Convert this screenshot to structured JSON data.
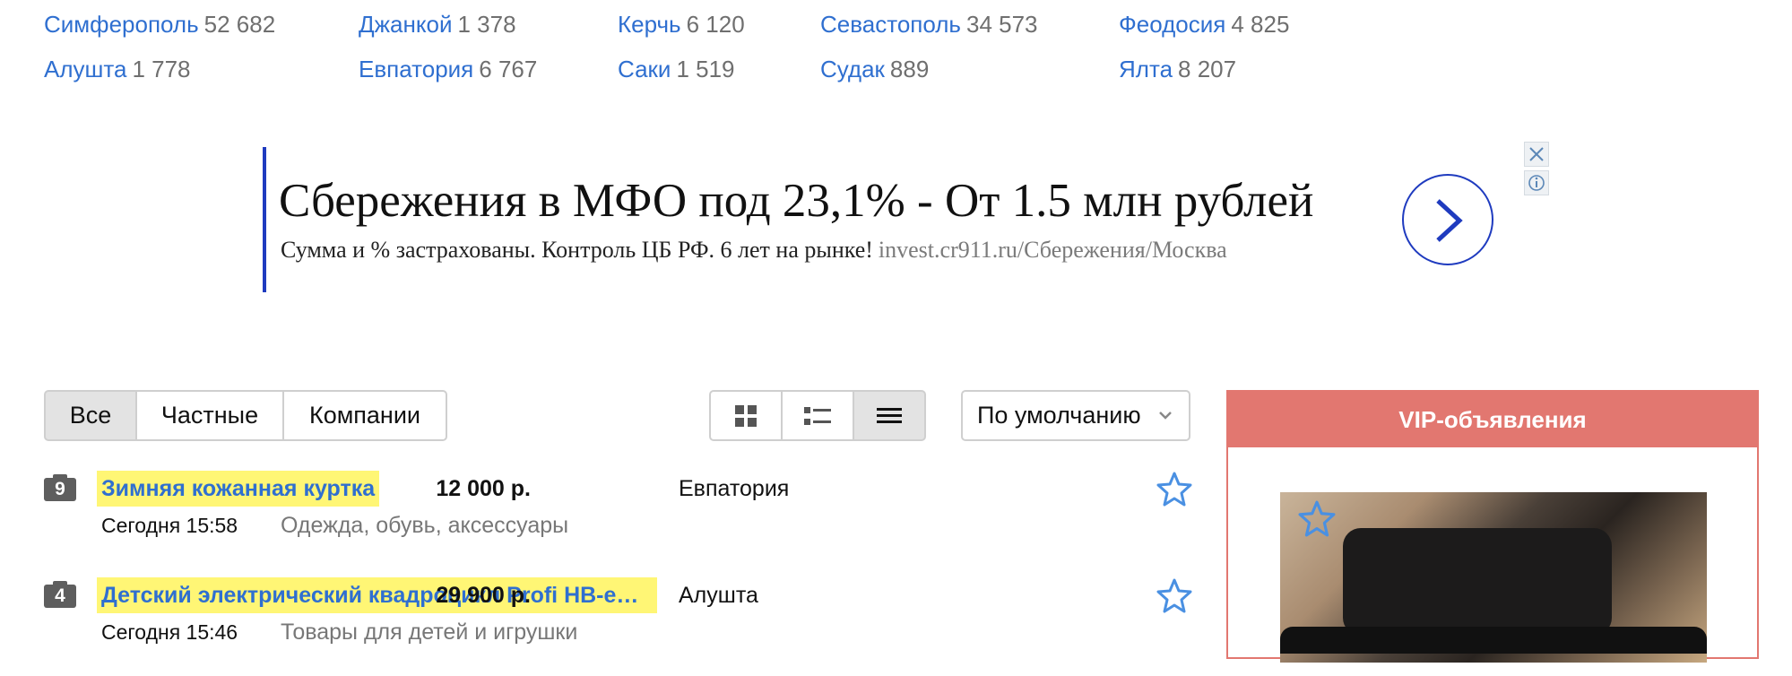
{
  "cities": [
    {
      "name": "Симферополь",
      "count": "52 682"
    },
    {
      "name": "Джанкой",
      "count": "1 378"
    },
    {
      "name": "Керчь",
      "count": "6 120"
    },
    {
      "name": "Севастополь",
      "count": "34 573"
    },
    {
      "name": "Феодосия",
      "count": "4 825"
    },
    {
      "name": "Алушта",
      "count": "1 778"
    },
    {
      "name": "Евпатория",
      "count": "6 767"
    },
    {
      "name": "Саки",
      "count": "1 519"
    },
    {
      "name": "Судак",
      "count": "889"
    },
    {
      "name": "Ялта",
      "count": "8 207"
    }
  ],
  "ad": {
    "title": "Сбережения в МФО под 23,1% - От 1.5 млн рублей",
    "description": "Сумма и % застрахованы. Контроль ЦБ РФ. 6 лет на рынке!",
    "url": "invest.cr911.ru/Сбережения/Москва",
    "accent_color": "#1f3bbf"
  },
  "filter": {
    "tabs": [
      "Все",
      "Частные",
      "Компании"
    ],
    "active": "Все"
  },
  "views": {
    "items": [
      "grid-view-icon",
      "list-view-icon",
      "compact-view-icon"
    ],
    "active": "compact-view-icon"
  },
  "sort": {
    "selected": "По умолчанию"
  },
  "listings": [
    {
      "photos": "9",
      "title": "Зимняя кожанная куртка",
      "date": "Сегодня 15:58",
      "category": "Одежда, обувь, аксессуары",
      "city": "Евпатория",
      "price": "12 000 р."
    },
    {
      "photos": "4",
      "title": "Детский электрический квадроцикл Profi HB-e…",
      "date": "Сегодня 15:46",
      "category": "Товары для детей и игрушки",
      "city": "Алушта",
      "price": "29 900 р."
    }
  ],
  "vip": {
    "header": "VIP-объявления",
    "color": "#e27770"
  },
  "colors": {
    "link": "#2f6fd0",
    "highlight": "#fff675",
    "star": "#4a90e2"
  }
}
